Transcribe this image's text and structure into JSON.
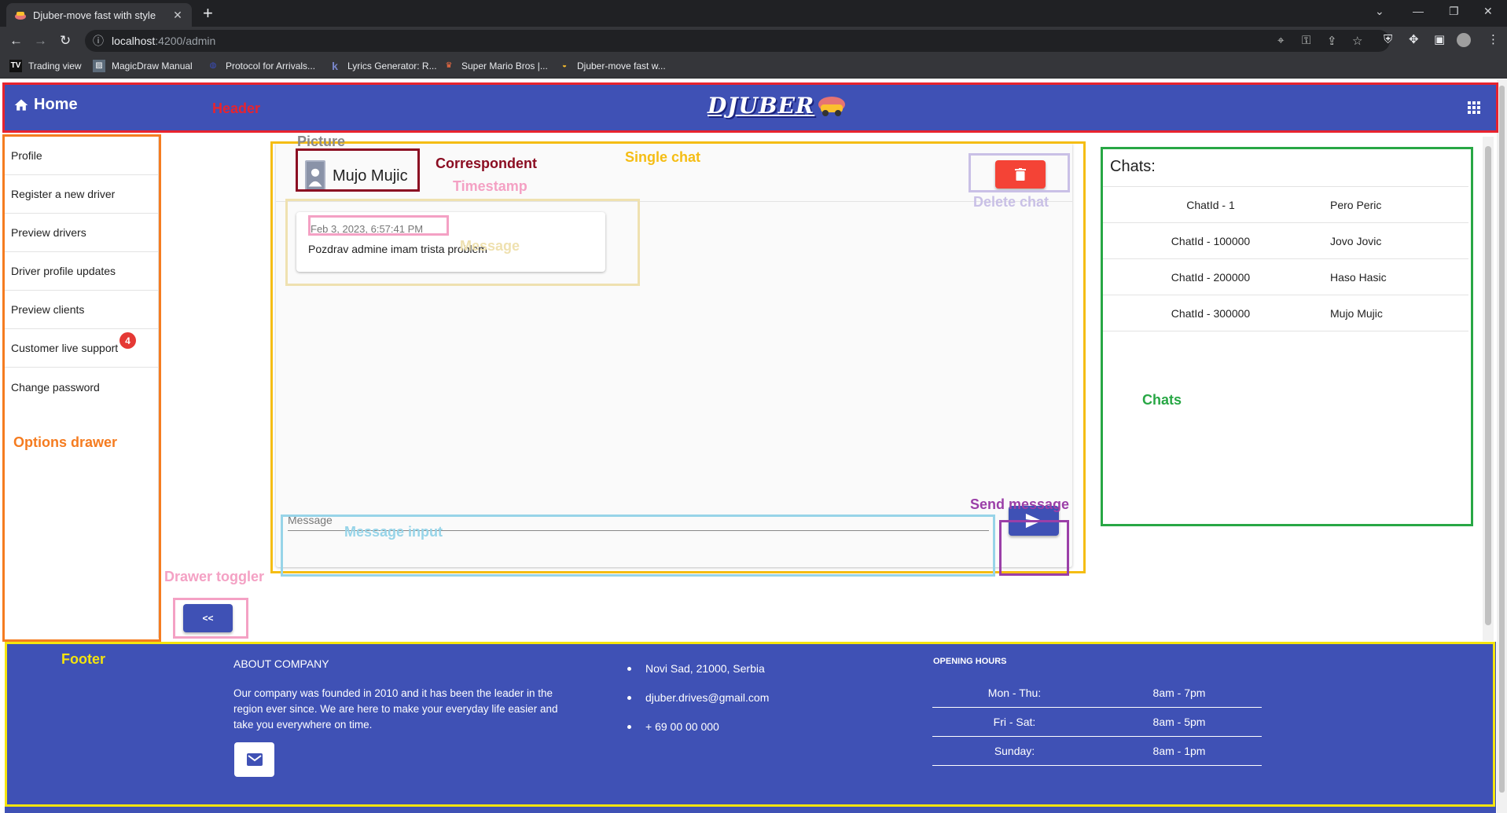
{
  "browser": {
    "tab_title": "Djuber-move fast with style",
    "url_host": "localhost",
    "url_path": ":4200/admin",
    "bookmarks": [
      "Trading view",
      "MagicDraw Manual",
      "Protocol for Arrivals...",
      "Lyrics Generator: R...",
      "Super Mario Bros |...",
      "Djuber-move fast w..."
    ]
  },
  "header": {
    "home_label": "Home",
    "logo_text": "DJUBER"
  },
  "drawer": {
    "items": [
      {
        "label": "Profile"
      },
      {
        "label": "Register a new driver"
      },
      {
        "label": "Preview drivers"
      },
      {
        "label": "Driver profile updates"
      },
      {
        "label": "Preview clients"
      },
      {
        "label": "Customer live support",
        "badge": "4"
      },
      {
        "label": "Change password"
      }
    ],
    "toggle_label": "<<"
  },
  "chat": {
    "correspondent": "Mujo Mujic",
    "messages": [
      {
        "timestamp": "Feb 3, 2023, 6:57:41 PM",
        "text": "Pozdrav admine imam trista problem"
      }
    ],
    "input_placeholder": "Message"
  },
  "chats": {
    "title": "Chats:",
    "rows": [
      {
        "id": "ChatId - 1",
        "name": "Pero Peric"
      },
      {
        "id": "ChatId - 100000",
        "name": "Jovo Jovic"
      },
      {
        "id": "ChatId - 200000",
        "name": "Haso Hasic"
      },
      {
        "id": "ChatId - 300000",
        "name": "Mujo Mujic"
      }
    ]
  },
  "footer": {
    "about_title": "ABOUT COMPANY",
    "about_text": "Our company was founded in 2010 and it has been the leader in the region ever since. We are here to make your everyday life easier and take you everywhere on time.",
    "contacts": [
      "Novi Sad, 21000, Serbia",
      "djuber.drives@gmail.com",
      "+ 69 00 00 000"
    ],
    "hours_title": "OPENING HOURS",
    "hours": [
      {
        "day": "Mon - Thu:",
        "time": "8am - 7pm"
      },
      {
        "day": "Fri - Sat:",
        "time": "8am - 5pm"
      },
      {
        "day": "Sunday:",
        "time": "8am - 1pm"
      }
    ]
  },
  "annotations": {
    "header": "Header",
    "picture": "Picture",
    "correspondent": "Correspondent",
    "single_chat": "Single chat",
    "timestamp": "Timestamp",
    "message": "Message",
    "delete_chat": "Delete chat",
    "chats": "Chats",
    "options_drawer": "Options drawer",
    "send_message": "Send message",
    "message_input": "Message input",
    "drawer_toggler": "Drawer toggler",
    "footer": "Footer"
  },
  "colors": {
    "primary": "#3f51b5",
    "delete": "#f44336",
    "badge": "#e53935"
  }
}
